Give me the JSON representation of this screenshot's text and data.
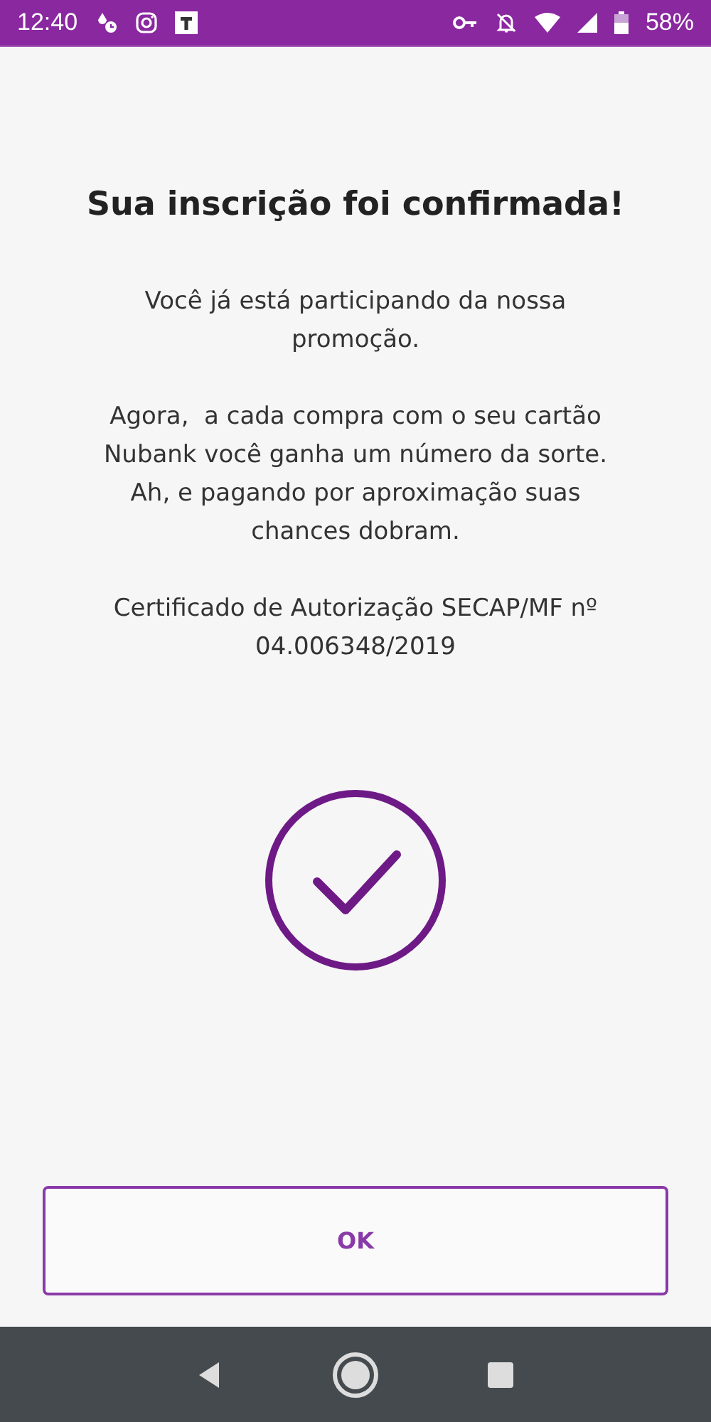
{
  "status_bar": {
    "time": "12:40",
    "battery": "58%"
  },
  "title": "Sua inscrição foi confirmada!",
  "paragraphs": [
    "Você já está participando da nossa\npromoção.",
    "Agora,  a cada compra com o seu cartão\nNubank você ganha um número da sorte.\nAh, e pagando por aproximação suas\nchances dobram.",
    "Certificado de Autorização SECAP/MF nº\n04.006348/2019"
  ],
  "button": {
    "label": "OK"
  }
}
